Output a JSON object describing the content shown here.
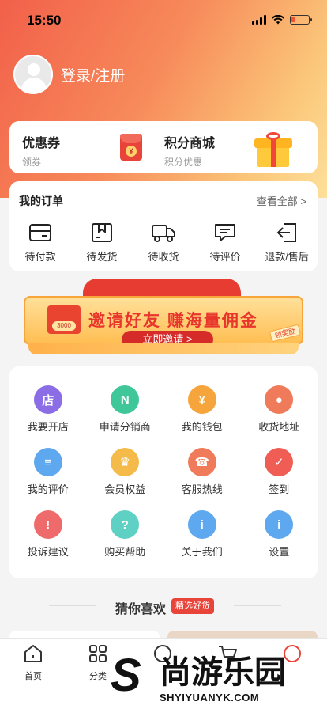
{
  "status_bar": {
    "time": "15:50"
  },
  "profile": {
    "login_label": "登录/注册"
  },
  "promo": {
    "coupon": {
      "title": "优惠券",
      "subtitle": "领券",
      "badge": "¥"
    },
    "points": {
      "title": "积分商城",
      "subtitle": "积分优惠"
    }
  },
  "orders": {
    "title": "我的订单",
    "view_all": "查看全部 >",
    "items": [
      {
        "label": "待付款",
        "icon": "wallet-icon"
      },
      {
        "label": "待发货",
        "icon": "package-icon"
      },
      {
        "label": "待收货",
        "icon": "truck-icon"
      },
      {
        "label": "待评价",
        "icon": "comment-icon"
      },
      {
        "label": "退款/售后",
        "icon": "return-icon"
      }
    ]
  },
  "banner": {
    "headline": "邀请好友 赚海量佣金",
    "cta": "立即邀请 >",
    "gift_label": "3000",
    "tag": "领奖励"
  },
  "services": {
    "items": [
      {
        "label": "我要开店",
        "icon": "shop-icon",
        "glyph": "店",
        "color": "#8b6ee6"
      },
      {
        "label": "申请分销商",
        "icon": "distributor-icon",
        "glyph": "N",
        "color": "#3fc79a"
      },
      {
        "label": "我的钱包",
        "icon": "wallet-coin-icon",
        "glyph": "¥",
        "color": "#f6a53c"
      },
      {
        "label": "收货地址",
        "icon": "location-icon",
        "glyph": "●",
        "color": "#f07b5a"
      },
      {
        "label": "我的评价",
        "icon": "document-icon",
        "glyph": "≡",
        "color": "#5da8ee"
      },
      {
        "label": "会员权益",
        "icon": "crown-icon",
        "glyph": "♛",
        "color": "#f5bb4a"
      },
      {
        "label": "客服热线",
        "icon": "headset-icon",
        "glyph": "☎",
        "color": "#f07b5a"
      },
      {
        "label": "签到",
        "icon": "checkin-icon",
        "glyph": "✓",
        "color": "#ef5d55"
      },
      {
        "label": "投诉建议",
        "icon": "warning-icon",
        "glyph": "!",
        "color": "#ef6b6b"
      },
      {
        "label": "购买帮助",
        "icon": "help-icon",
        "glyph": "?",
        "color": "#5fd0c4"
      },
      {
        "label": "关于我们",
        "icon": "info-icon",
        "glyph": "i",
        "color": "#5da8ee"
      },
      {
        "label": "设置",
        "icon": "settings-icon",
        "glyph": "i",
        "color": "#5da8ee"
      }
    ]
  },
  "guess": {
    "title": "猜你喜欢",
    "tag": "精选好货"
  },
  "tabbar": {
    "home": "首页",
    "category": "分类"
  },
  "watermark": {
    "brand": "尚游乐园",
    "url": "SHYIYUANYK.COM"
  }
}
